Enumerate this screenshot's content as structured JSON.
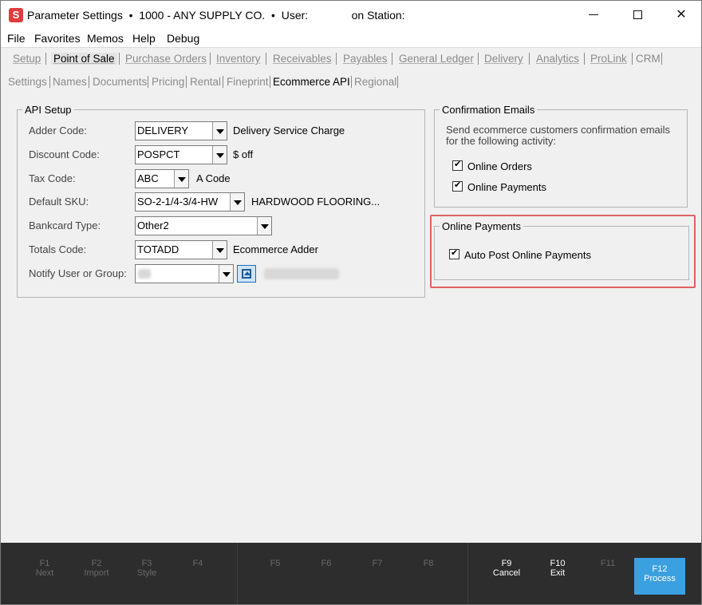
{
  "window": {
    "title": "Parameter Settings  •  1000 - ANY SUPPLY CO.  •  User:              on Station:",
    "app_icon_letter": "S",
    "controls": {
      "minimize": "—",
      "maximize": "☐",
      "close": "✕"
    }
  },
  "menubar": {
    "items": [
      "File",
      "Favorites",
      "Memos",
      "Help",
      "Debug"
    ]
  },
  "module_tabs": [
    "Setup",
    "Point of Sale",
    "Purchase Orders",
    "Inventory",
    "Receivables",
    "Payables",
    "General Ledger",
    "Delivery",
    "Analytics",
    "ProLink",
    "CRM"
  ],
  "sub_tabs": [
    "Settings",
    "Names",
    "Documents",
    "Pricing",
    "Rental",
    "Fineprint",
    "Ecommerce API",
    "Regional"
  ],
  "api_setup": {
    "title": "API Setup",
    "adder_code": {
      "label": "Adder Code:",
      "value": "DELIVERY",
      "description": "Delivery Service Charge"
    },
    "discount_code": {
      "label": "Discount Code:",
      "value": "POSPCT",
      "description": "$ off"
    },
    "tax_code": {
      "label": "Tax Code:",
      "value": "ABC",
      "description": "A Code"
    },
    "default_sku": {
      "label": "Default SKU:",
      "value": "SO-2-1/4-3/4-HW",
      "description": "HARDWOOD FLOORING..."
    },
    "bankcard_type": {
      "label": "Bankcard Type:",
      "value": "Other2"
    },
    "totals_code": {
      "label": "Totals Code:",
      "value": "TOTADD",
      "description": "Ecommerce Adder"
    },
    "notify": {
      "label": "Notify User or Group:"
    }
  },
  "confirmation_emails": {
    "title": "Confirmation Emails",
    "info": "Send ecommerce customers confirmation emails for the following activity:",
    "online_orders": {
      "label": "Online Orders",
      "checked": true
    },
    "online_payments": {
      "label": "Online Payments",
      "checked": true
    }
  },
  "online_payments": {
    "title": "Online Payments",
    "auto_post": {
      "label": "Auto Post Online Payments",
      "checked": true
    }
  },
  "function_keys": [
    {
      "key": "F1",
      "label": "Next",
      "enabled": false
    },
    {
      "key": "F2",
      "label": "Import",
      "enabled": false
    },
    {
      "key": "F3",
      "label": "Style",
      "enabled": false
    },
    {
      "key": "F4",
      "label": "",
      "enabled": false
    },
    {
      "key": "F5",
      "label": "",
      "enabled": false
    },
    {
      "key": "F6",
      "label": "",
      "enabled": false
    },
    {
      "key": "F7",
      "label": "",
      "enabled": false
    },
    {
      "key": "F8",
      "label": "",
      "enabled": false
    },
    {
      "key": "F9",
      "label": "Cancel",
      "enabled": true
    },
    {
      "key": "F10",
      "label": "Exit",
      "enabled": true
    },
    {
      "key": "F11",
      "label": "",
      "enabled": false
    },
    {
      "key": "F12",
      "label": "Process",
      "enabled": true
    }
  ],
  "colors": {
    "accent": "#3aa0e0",
    "highlight": "#e06262",
    "fkey_bar": "#2d2d2d",
    "app_icon": "#e03c3c"
  }
}
